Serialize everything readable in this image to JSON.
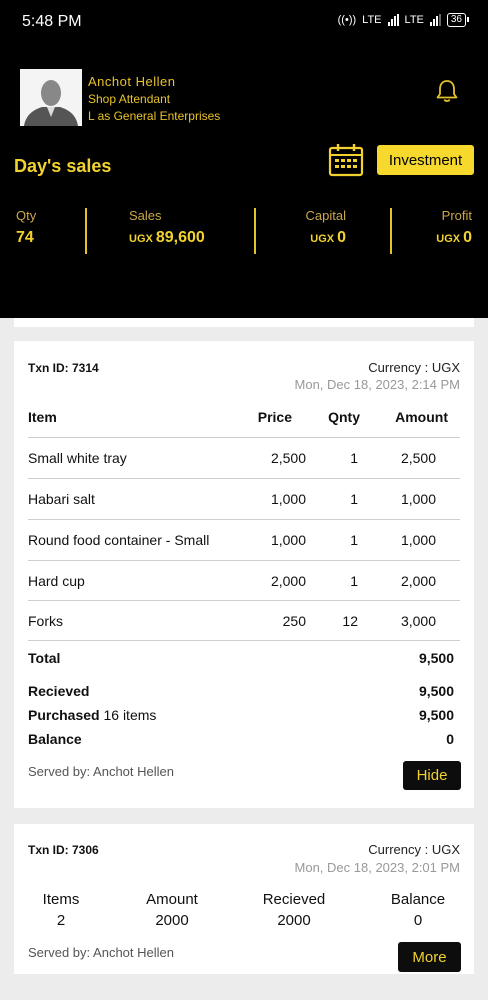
{
  "status": {
    "time": "5:48 PM",
    "battery": "36",
    "net1": "LTE",
    "net2": "LTE"
  },
  "user": {
    "name": "Anchot Hellen",
    "role": "Shop Attendant",
    "business": "L     as General Enterprises"
  },
  "dashboard": {
    "title": "Day's sales",
    "investment_label": "Investment",
    "stats": [
      {
        "label": "Qty",
        "currency": "",
        "value": "74"
      },
      {
        "label": "Sales",
        "currency": "UGX",
        "value": "89,600"
      },
      {
        "label": "Capital",
        "currency": "UGX",
        "value": "0"
      },
      {
        "label": "Profit",
        "currency": "UGX",
        "value": "0"
      }
    ]
  },
  "txn1": {
    "id": "Txn ID: 7314",
    "currency": "Currency : UGX",
    "date": "Mon, Dec 18, 2023, 2:14 PM",
    "headers": {
      "item": "Item",
      "price": "Price",
      "qty": "Qnty",
      "amount": "Amount"
    },
    "rows": [
      {
        "item": "Small white tray",
        "price": "2,500",
        "qty": "1",
        "amount": "2,500"
      },
      {
        "item": "Habari salt",
        "price": "1,000",
        "qty": "1",
        "amount": "1,000"
      },
      {
        "item": "Round food container - Small",
        "price": "1,000",
        "qty": "1",
        "amount": "1,000"
      },
      {
        "item": "Hard cup",
        "price": "2,000",
        "qty": "1",
        "amount": "2,000"
      },
      {
        "item": "Forks",
        "price": "250",
        "qty": "12",
        "amount": "3,000"
      }
    ],
    "total_label": "Total",
    "total_value": "9,500",
    "received_label": "Recieved",
    "received_value": "9,500",
    "purchased_label": "Purchased",
    "purchased_items": "16 items",
    "purchased_value": "9,500",
    "balance_label": "Balance",
    "balance_value": "0",
    "served_by": "Served by: Anchot Hellen",
    "hide_label": "Hide"
  },
  "txn2": {
    "id": "Txn ID: 7306",
    "currency": "Currency : UGX",
    "date": "Mon, Dec 18, 2023, 2:01 PM",
    "summary": [
      {
        "label": "Items",
        "value": "2"
      },
      {
        "label": "Amount",
        "value": "2000"
      },
      {
        "label": "Recieved",
        "value": "2000"
      },
      {
        "label": "Balance",
        "value": "0"
      }
    ],
    "served_by": "Served by: Anchot Hellen",
    "more_label": "More"
  },
  "colors": {
    "accent": "#f2d22e",
    "header_bg": "#000000",
    "page_bg": "#ececec"
  },
  "icons": {
    "bell": "bell-icon",
    "calendar": "calendar-icon",
    "avatar": "user-avatar"
  }
}
